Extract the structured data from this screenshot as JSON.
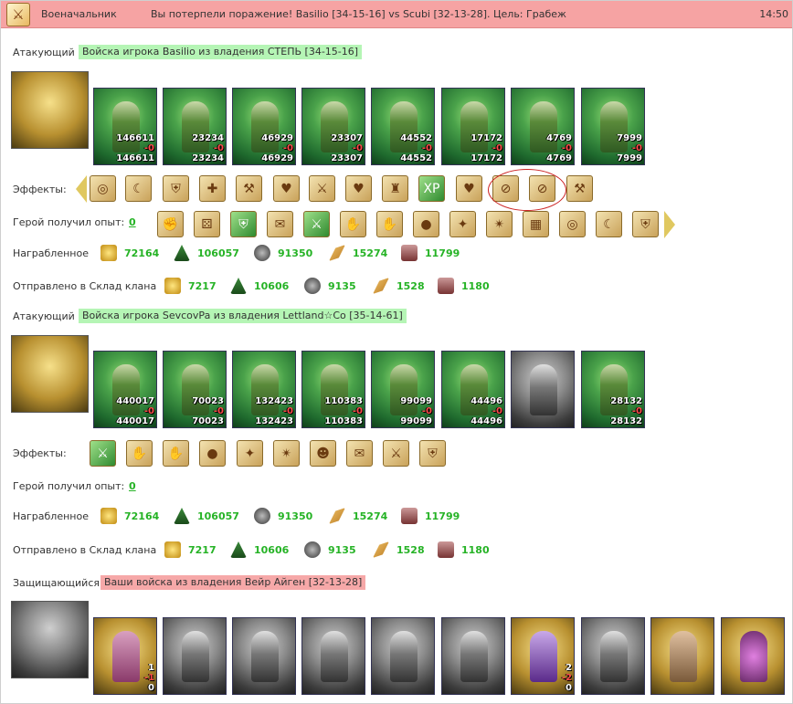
{
  "header": {
    "rank": "Военачальник",
    "message": "Вы потерпели поражение! Basilio [34-15-16] vs Scubi [32-13-28]. Цель: Грабеж",
    "time": "14:50"
  },
  "labels": {
    "attacker": "Атакующий",
    "defender": "Защищающийся",
    "effects": "Эффекты:",
    "hero_exp": "Герой получил опыт:",
    "looted": "Награбленное",
    "sent": "Отправлено в Склад клана"
  },
  "attacker1": {
    "army": "Войска игрока Basilio из владения СТЕПЬ [34-15-16]",
    "exp": "0",
    "units": [
      {
        "a": "146611",
        "b": "-0",
        "c": "146611"
      },
      {
        "a": "23234",
        "b": "-0",
        "c": "23234"
      },
      {
        "a": "46929",
        "b": "-0",
        "c": "46929"
      },
      {
        "a": "23307",
        "b": "-0",
        "c": "23307"
      },
      {
        "a": "44552",
        "b": "-0",
        "c": "44552"
      },
      {
        "a": "17172",
        "b": "-0",
        "c": "17172"
      },
      {
        "a": "4769",
        "b": "-0",
        "c": "4769"
      },
      {
        "a": "7999",
        "b": "-0",
        "c": "7999"
      }
    ],
    "loot": [
      "72164",
      "106057",
      "91350",
      "15274",
      "11799"
    ],
    "sent": [
      "7217",
      "10606",
      "9135",
      "1528",
      "1180"
    ]
  },
  "attacker2": {
    "army": "Войска игрока SevcovPa из владения Lettland☆Co [35-14-61]",
    "exp": "0",
    "units": [
      {
        "a": "440017",
        "b": "-0",
        "c": "440017"
      },
      {
        "a": "70023",
        "b": "-0",
        "c": "70023"
      },
      {
        "a": "132423",
        "b": "-0",
        "c": "132423"
      },
      {
        "a": "110383",
        "b": "-0",
        "c": "110383"
      },
      {
        "a": "99099",
        "b": "-0",
        "c": "99099"
      },
      {
        "a": "44496",
        "b": "-0",
        "c": "44496"
      },
      {
        "a": "",
        "b": "",
        "c": ""
      },
      {
        "a": "28132",
        "b": "-0",
        "c": "28132"
      }
    ],
    "loot": [
      "72164",
      "106057",
      "91350",
      "15274",
      "11799"
    ],
    "sent": [
      "7217",
      "10606",
      "9135",
      "1528",
      "1180"
    ]
  },
  "defender": {
    "army": "Ваши войска из владения Вейр Айген [32-13-28]",
    "units": [
      {
        "a": "1",
        "b": "-1",
        "c": "0"
      },
      {
        "a": "",
        "b": "",
        "c": ""
      },
      {
        "a": "",
        "b": "",
        "c": ""
      },
      {
        "a": "",
        "b": "",
        "c": ""
      },
      {
        "a": "",
        "b": "",
        "c": ""
      },
      {
        "a": "",
        "b": "",
        "c": ""
      },
      {
        "a": "2",
        "b": "-2",
        "c": "0"
      },
      {
        "a": "",
        "b": "",
        "c": ""
      },
      {
        "a": "",
        "b": "",
        "c": ""
      },
      {
        "a": "",
        "b": "",
        "c": ""
      }
    ]
  },
  "effects_icons": {
    "e1": "XP"
  }
}
